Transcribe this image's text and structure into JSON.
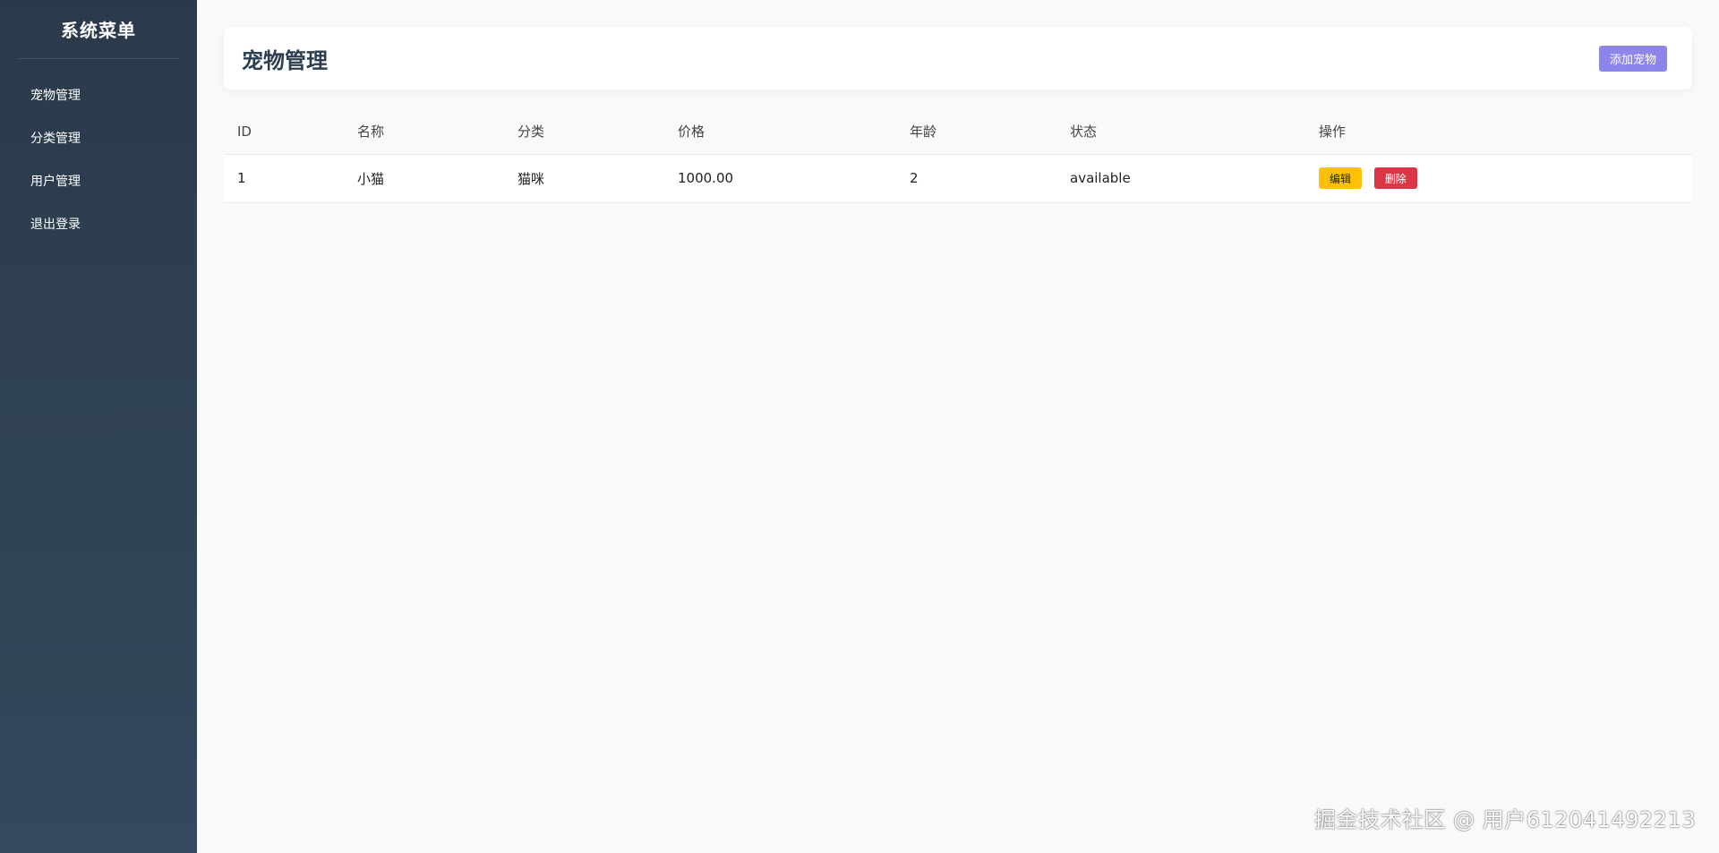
{
  "sidebar": {
    "title": "系统菜单",
    "items": [
      {
        "label": "宠物管理"
      },
      {
        "label": "分类管理"
      },
      {
        "label": "用户管理"
      },
      {
        "label": "退出登录"
      }
    ]
  },
  "header": {
    "title": "宠物管理",
    "add_label": "添加宠物"
  },
  "table": {
    "columns": [
      "ID",
      "名称",
      "分类",
      "价格",
      "年龄",
      "状态",
      "操作"
    ],
    "rows": [
      {
        "id": "1",
        "name": "小猫",
        "category": "猫咪",
        "price": "1000.00",
        "age": "2",
        "status": "available",
        "edit_label": "编辑",
        "delete_label": "删除"
      }
    ]
  },
  "watermark": "掘金技术社区 @ 用户612041492213",
  "colors": {
    "sidebar_bg": "#2b3a4b",
    "primary_button": "#8e85ea",
    "edit_button": "#ffc107",
    "delete_button": "#dc3545"
  }
}
